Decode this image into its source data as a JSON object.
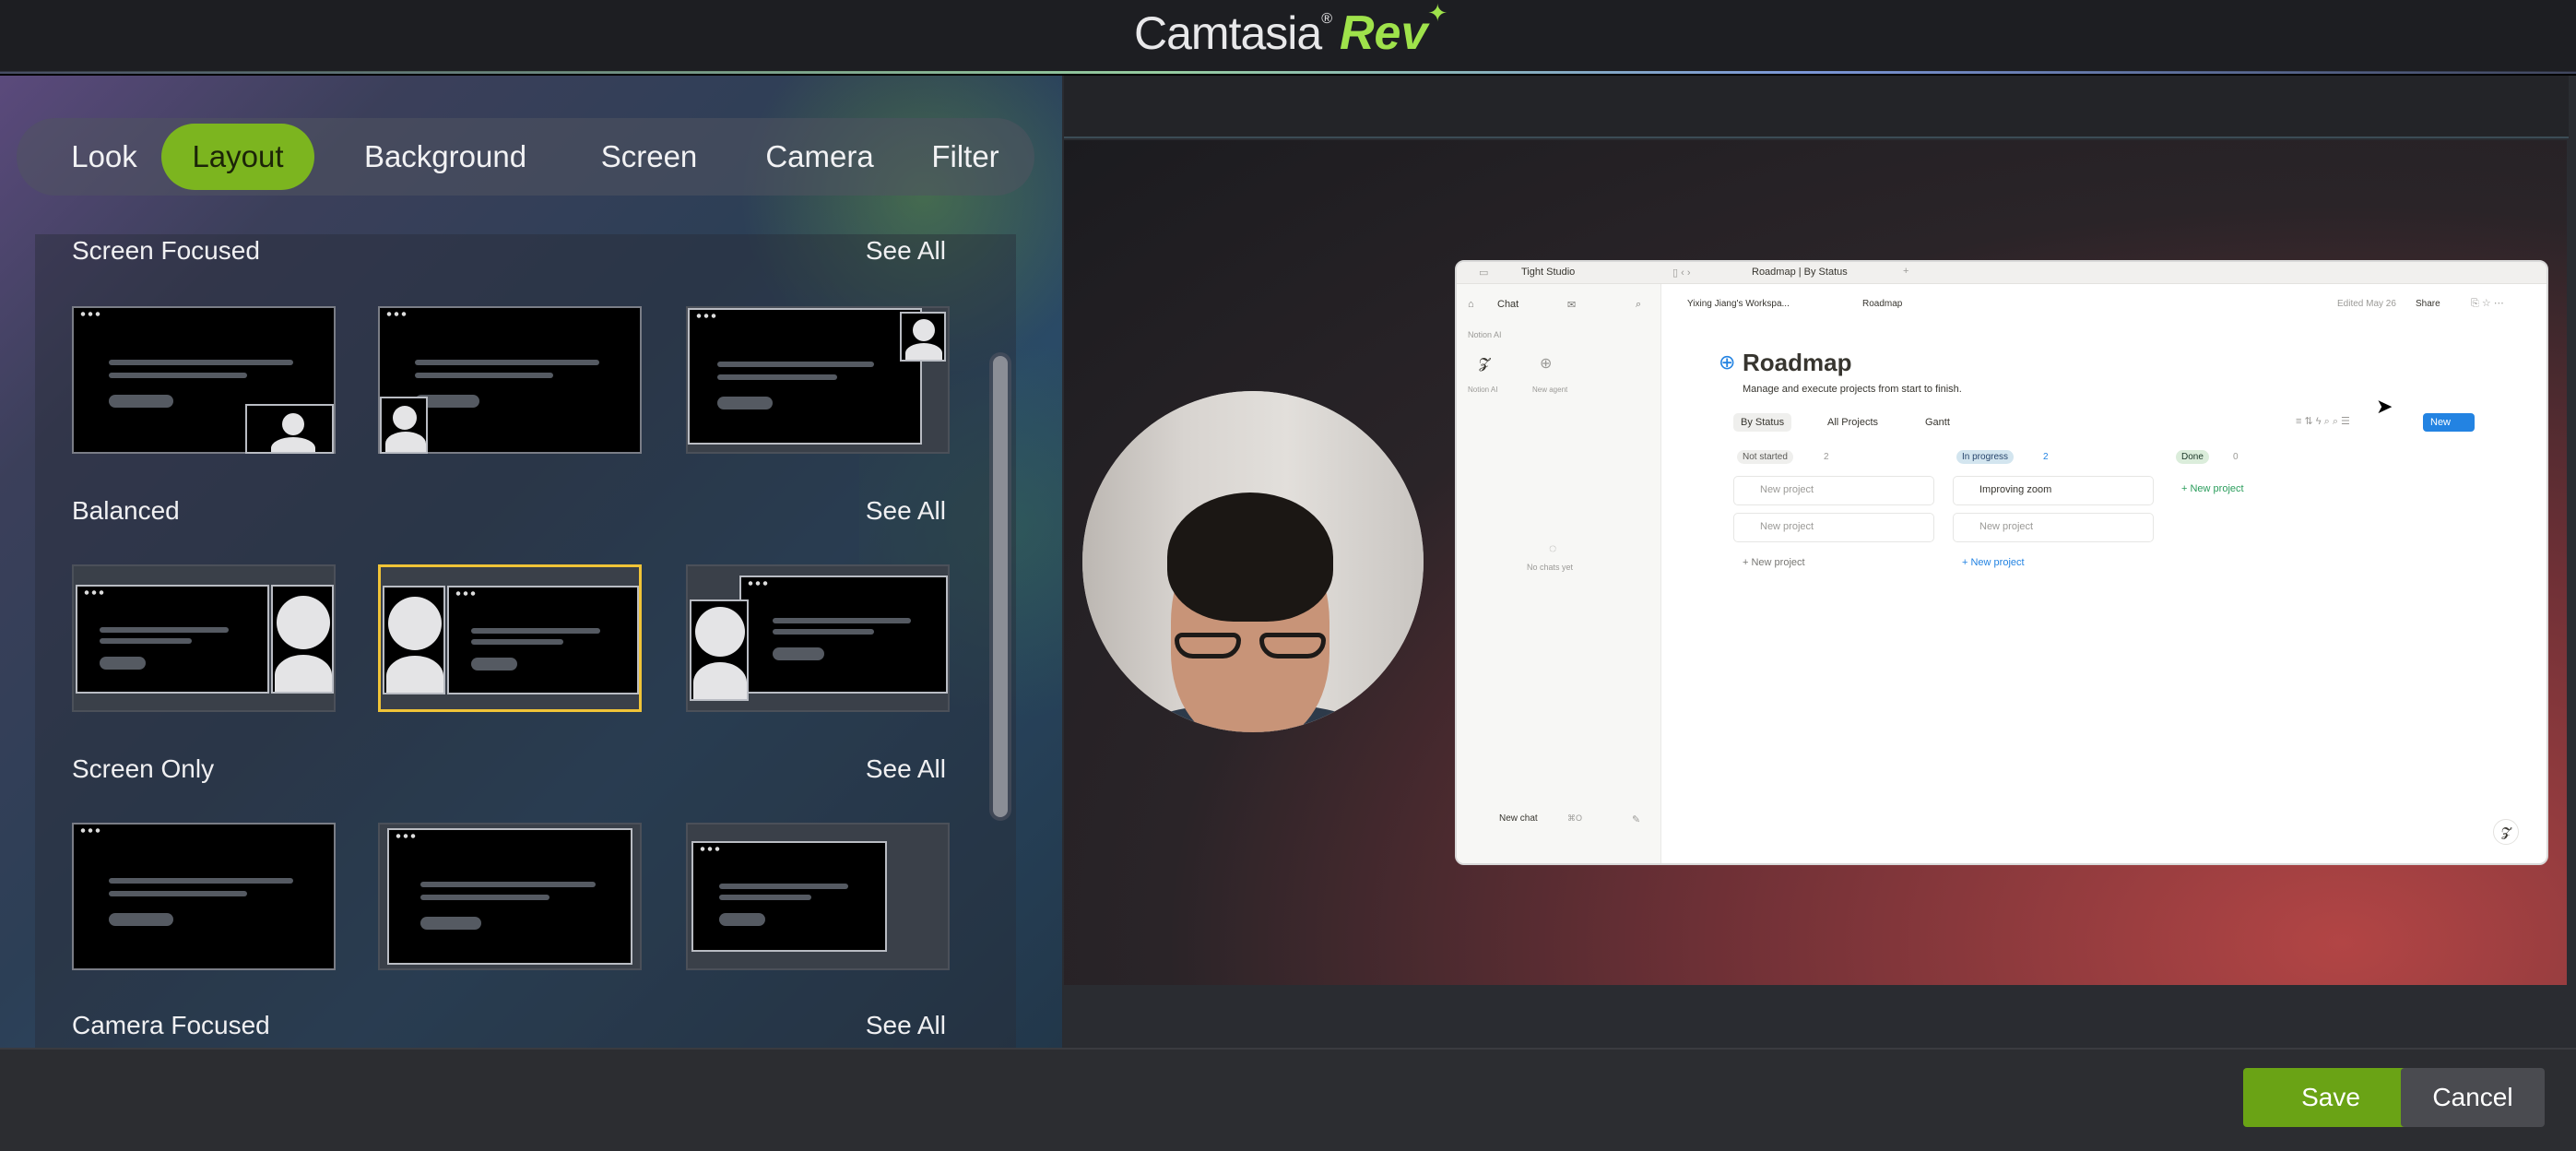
{
  "app": {
    "brand": "Camtasia",
    "brand_mark": "®",
    "product": "Rev",
    "spark": "✦"
  },
  "tabs": [
    "Look",
    "Layout",
    "Background",
    "Screen",
    "Camera",
    "Filter"
  ],
  "active_tab": "Layout",
  "library": {
    "see_all": "See All",
    "sections": [
      {
        "title": "Screen Focused"
      },
      {
        "title": "Balanced"
      },
      {
        "title": "Screen Only"
      },
      {
        "title": "Camera Focused"
      }
    ]
  },
  "notion": {
    "workspace": "Tight Studio",
    "tab_title": "Roadmap | By Status",
    "chat": "Chat",
    "notion_ai": "Notion AI",
    "notion_ai_label": "Notion AI",
    "new_agent": "New agent",
    "no_chats": "No chats yet",
    "new_chat": "New chat",
    "new_chat_shortcut": "⌘O",
    "breadcrumb_workspace": "Yixing Jiang's Workspa...",
    "breadcrumb_page": "Roadmap",
    "edited": "Edited May 26",
    "share": "Share",
    "title": "Roadmap",
    "subtitle": "Manage and execute projects from start to finish.",
    "views": [
      "By Status",
      "All Projects",
      "Gantt"
    ],
    "new_button": "New",
    "columns": [
      {
        "label": "Not started",
        "count": "2",
        "cards": [
          "New project",
          "New project"
        ],
        "add": "+ New project"
      },
      {
        "label": "In progress",
        "count": "2",
        "cards": [
          "Improving zoom",
          "New project"
        ],
        "add": "+ New project"
      },
      {
        "label": "Done",
        "count": "0",
        "cards": [],
        "add": "+ New project"
      }
    ]
  },
  "actions": {
    "save": "Save",
    "cancel": "Cancel"
  },
  "colors": {
    "accent": "#7cb51f",
    "selected_border": "#f0c437",
    "save": "#6aa315",
    "cancel": "#4a4b50"
  }
}
